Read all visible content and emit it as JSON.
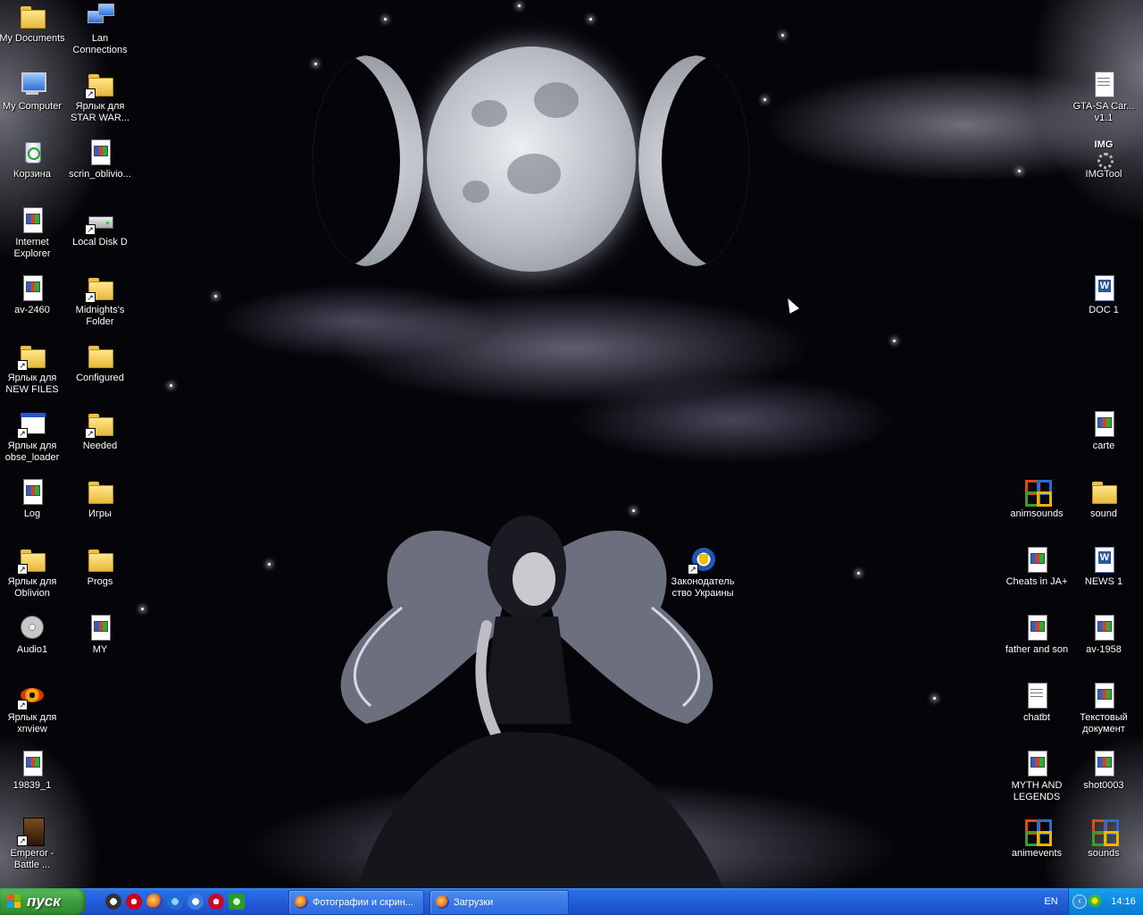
{
  "desktop": {
    "icons": [
      {
        "label": "My Documents",
        "type": "folder"
      },
      {
        "label": "Lan Connections",
        "type": "net"
      },
      {
        "label": "My Computer",
        "type": "pc"
      },
      {
        "label": "Ярлык для STAR WAR...",
        "type": "folder",
        "shortcut": true
      },
      {
        "label": "Корзина",
        "type": "bin"
      },
      {
        "label": "scrin_oblivio...",
        "type": "doc"
      },
      {
        "label": "Internet Explorer",
        "type": "doc"
      },
      {
        "label": "Local Disk D",
        "type": "disk",
        "shortcut": true
      },
      {
        "label": "av-2460",
        "type": "doc"
      },
      {
        "label": "Midnights's Folder",
        "type": "folder",
        "shortcut": true
      },
      {
        "label": "Ярлык для NEW FILES",
        "type": "folder",
        "shortcut": true
      },
      {
        "label": "Configured",
        "type": "folder"
      },
      {
        "label": "Ярлык для obse_loader",
        "type": "window",
        "shortcut": true
      },
      {
        "label": "Needed",
        "type": "folder",
        "shortcut": true
      },
      {
        "label": "Log",
        "type": "doc"
      },
      {
        "label": "Игры",
        "type": "folder"
      },
      {
        "label": "Ярлык для Oblivion",
        "type": "folder",
        "shortcut": true
      },
      {
        "label": "Progs",
        "type": "folder"
      },
      {
        "label": "Audio1",
        "type": "audio"
      },
      {
        "label": "MY",
        "type": "doc"
      },
      {
        "label": "Ярлык для xnview",
        "type": "xview",
        "shortcut": true
      },
      {
        "label": "19839_1",
        "type": "doc"
      },
      {
        "label": "Emperor - Battle ...",
        "type": "game",
        "shortcut": true
      },
      {
        "label": "Законодательство Украины",
        "type": "law",
        "shortcut": true
      },
      {
        "label": "GTA-SA Car... v1.1",
        "type": "txt"
      },
      {
        "label": "IMGTool",
        "type": "img"
      },
      {
        "label": "DOC 1",
        "type": "word"
      },
      {
        "label": "carte",
        "type": "doc"
      },
      {
        "label": "animsounds",
        "type": "office"
      },
      {
        "label": "sound",
        "type": "folder"
      },
      {
        "label": "Cheats in JA+",
        "type": "doc"
      },
      {
        "label": "NEWS 1",
        "type": "word"
      },
      {
        "label": "father and son",
        "type": "doc"
      },
      {
        "label": "av-1958",
        "type": "doc"
      },
      {
        "label": "chatbt",
        "type": "txt"
      },
      {
        "label": "Текстовый документ",
        "type": "doc"
      },
      {
        "label": "MYTH AND LEGENDS",
        "type": "doc"
      },
      {
        "label": "shot0003",
        "type": "doc"
      },
      {
        "label": "animevents",
        "type": "office"
      },
      {
        "label": "sounds",
        "type": "office"
      }
    ]
  },
  "taskbar": {
    "start_label": "пуск",
    "quicklaunch": [
      "media-player-icon",
      "opera-icon",
      "firefox-icon",
      "ie-icon",
      "email-icon",
      "opera-mini-icon",
      "network-icon"
    ],
    "quicklaunch_more": "»",
    "tasks": [
      {
        "label": "Фотографии и скрин..."
      },
      {
        "label": "Загрузки"
      }
    ],
    "language": "EN",
    "clock": "14:16"
  }
}
